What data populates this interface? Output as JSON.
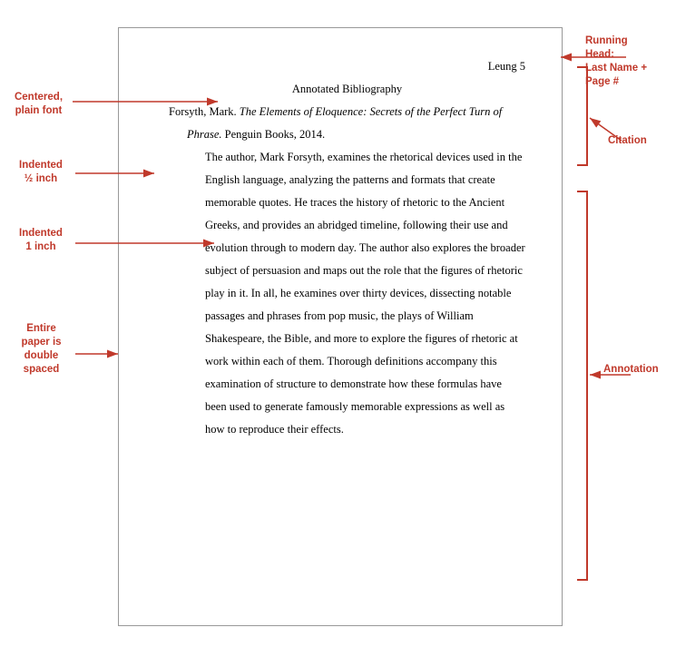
{
  "labels": {
    "centered": "Centered,\nplain font",
    "half_inch": "Indented\n½ inch",
    "one_inch": "Indented\n1 inch",
    "double_spaced": "Entire\npaper is\ndouble\nspaced",
    "running_head": "Running\nHead:\nLast Name +\nPage #",
    "citation": "Citation",
    "annotation": "Annotation"
  },
  "paper": {
    "header": "Leung 5",
    "title": "Annotated Bibliography",
    "citation_text": "Forsyth, Mark.",
    "citation_italic": "The Elements of Eloquence: Secrets of the Perfect Turn of Phrase.",
    "citation_rest": " Penguin Books, 2014.",
    "annotation": "The author, Mark Forsyth, examines the rhetorical devices used in the English language, analyzing the patterns and formats that create memorable quotes. He traces the history of rhetoric to the Ancient Greeks, and provides an abridged timeline, following their use and evolution through to modern day. The author also explores the broader subject of persuasion and maps out the role that the figures of rhetoric play in it. In all, he examines over thirty devices, dissecting notable passages and phrases from pop music, the plays of William Shakespeare, the Bible, and more to explore the figures of rhetoric at work within each of them. Thorough definitions accompany this examination of structure to demonstrate how these formulas have been used to generate famously memorable expressions as well as how to reproduce their effects."
  }
}
